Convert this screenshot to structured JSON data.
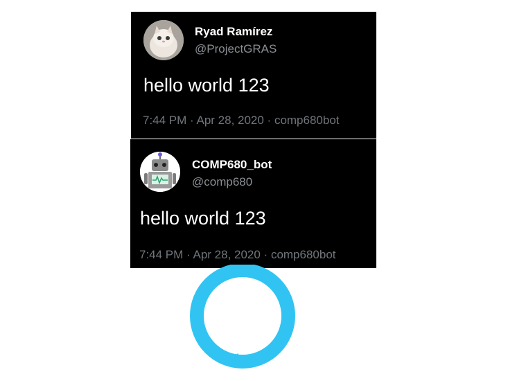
{
  "tweets": [
    {
      "display_name": "Ryad Ramírez",
      "handle": "@ProjectGRAS",
      "text": "hello world 123",
      "meta": "7:44 PM · Apr 28, 2020 · comp680bot",
      "avatar_icon": "kitten-avatar"
    },
    {
      "display_name": "COMP680_bot",
      "handle": "@comp680",
      "text": "hello world 123",
      "meta": "7:44 PM · Apr 28, 2020 · comp680bot",
      "avatar_icon": "robot-avatar"
    }
  ],
  "bubble": {
    "text": "hello world 123",
    "icon": "speech-bubble-icon",
    "color": "#31c4f3"
  }
}
